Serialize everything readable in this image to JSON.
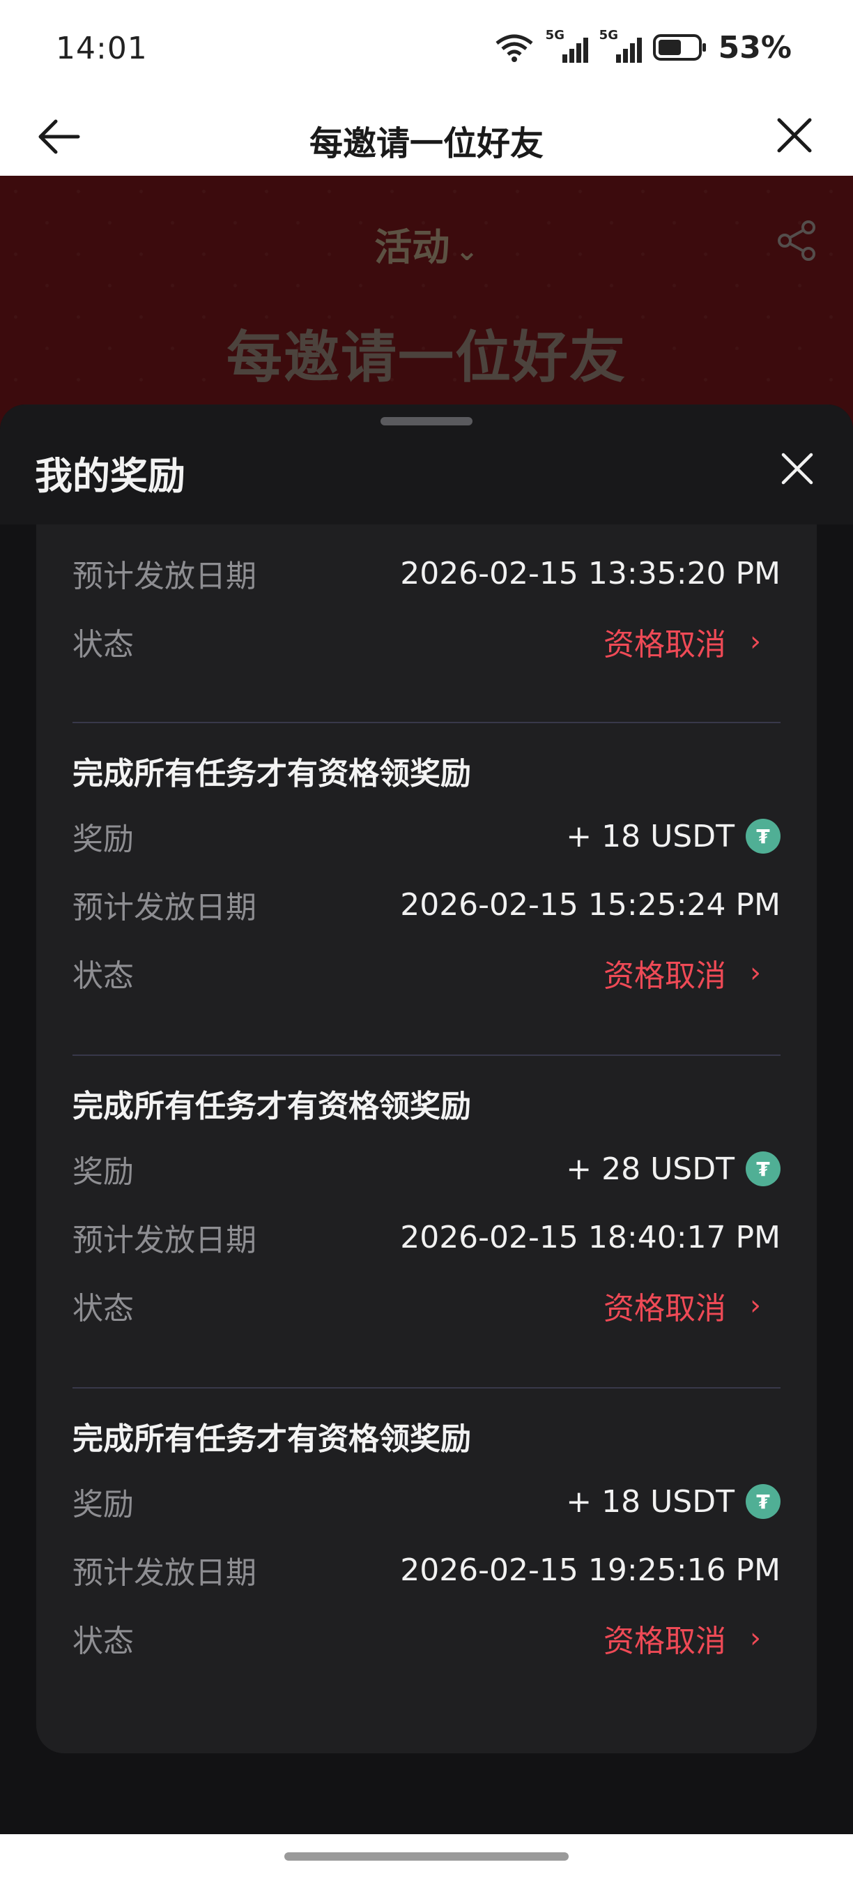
{
  "status_bar": {
    "time": "14:01",
    "signal1": "5G",
    "signal2": "5G",
    "battery": "53%"
  },
  "nav": {
    "title": "每邀请一位好友"
  },
  "hero": {
    "activity_label": "活动",
    "headline": "每邀请一位好友"
  },
  "sheet": {
    "title": "我的奖励",
    "partial_item": {
      "date_label": "预计发放日期",
      "date_value": "2026-02-15 13:35:20 PM",
      "status_label": "状态",
      "status_value": "资格取消"
    },
    "items": [
      {
        "title": "完成所有任务才有资格领奖励",
        "reward_label": "奖励",
        "reward_value": "+ 18 USDT",
        "date_label": "预计发放日期",
        "date_value": "2026-02-15 15:25:24 PM",
        "status_label": "状态",
        "status_value": "资格取消"
      },
      {
        "title": "完成所有任务才有资格领奖励",
        "reward_label": "奖励",
        "reward_value": "+ 28 USDT",
        "date_label": "预计发放日期",
        "date_value": "2026-02-15 18:40:17 PM",
        "status_label": "状态",
        "status_value": "资格取消"
      },
      {
        "title": "完成所有任务才有资格领奖励",
        "reward_label": "奖励",
        "reward_value": "+ 18 USDT",
        "date_label": "预计发放日期",
        "date_value": "2026-02-15 19:25:16 PM",
        "status_label": "状态",
        "status_value": "资格取消"
      }
    ]
  },
  "colors": {
    "accent_red": "#ef4a56",
    "usdt_green": "#50af95",
    "hero_red": "#6e1518"
  },
  "icons": [
    "wifi-icon",
    "signal-icon",
    "battery-icon",
    "back-arrow-icon",
    "close-icon",
    "chevron-down-icon",
    "share-icon",
    "usdt-icon",
    "chevron-right-icon"
  ]
}
